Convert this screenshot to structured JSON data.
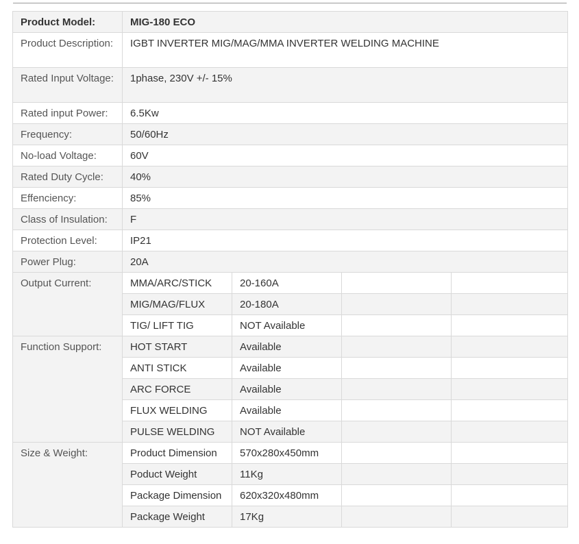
{
  "header": {
    "label": "Product Model:",
    "value": "MIG-180 ECO"
  },
  "simple_rows": [
    {
      "label": "Product Description:",
      "value": "IGBT INVERTER MIG/MAG/MMA INVERTER WELDING MACHINE"
    },
    {
      "label": "Rated Input Voltage:",
      "value": "1phase, 230V +/- 15%"
    },
    {
      "label": "Rated input Power:",
      "value": "6.5Kw"
    },
    {
      "label": "Frequency:",
      "value": "50/60Hz"
    },
    {
      "label": "No-load Voltage:",
      "value": "60V"
    },
    {
      "label": "Rated Duty Cycle:",
      "value": "40%"
    },
    {
      "label": "Effenciency:",
      "value": "85%"
    },
    {
      "label": "Class of Insulation:",
      "value": "F"
    },
    {
      "label": "Protection Level:",
      "value": "IP21"
    },
    {
      "label": "Power Plug:",
      "value": "20A"
    }
  ],
  "groups": [
    {
      "label": "Output Current:",
      "rows": [
        {
          "name": "MMA/ARC/STICK",
          "value": "20-160A"
        },
        {
          "name": "MIG/MAG/FLUX",
          "value": "20-180A"
        },
        {
          "name": "TIG/ LIFT TIG",
          "value": "NOT Available"
        }
      ]
    },
    {
      "label": "Function Support:",
      "rows": [
        {
          "name": "HOT START",
          "value": "Available"
        },
        {
          "name": "ANTI STICK",
          "value": "Available"
        },
        {
          "name": "ARC FORCE",
          "value": "Available"
        },
        {
          "name": "FLUX WELDING",
          "value": "Available"
        },
        {
          "name": "PULSE WELDING",
          "value": "NOT Available"
        }
      ]
    },
    {
      "label": "Size & Weight:",
      "rows": [
        {
          "name": "Product Dimension",
          "value": "570x280x450mm"
        },
        {
          "name": "Poduct Weight",
          "value": "11Kg"
        },
        {
          "name": "Package Dimension",
          "value": "620x320x480mm"
        },
        {
          "name": "Package Weight",
          "value": "17Kg"
        }
      ]
    }
  ]
}
